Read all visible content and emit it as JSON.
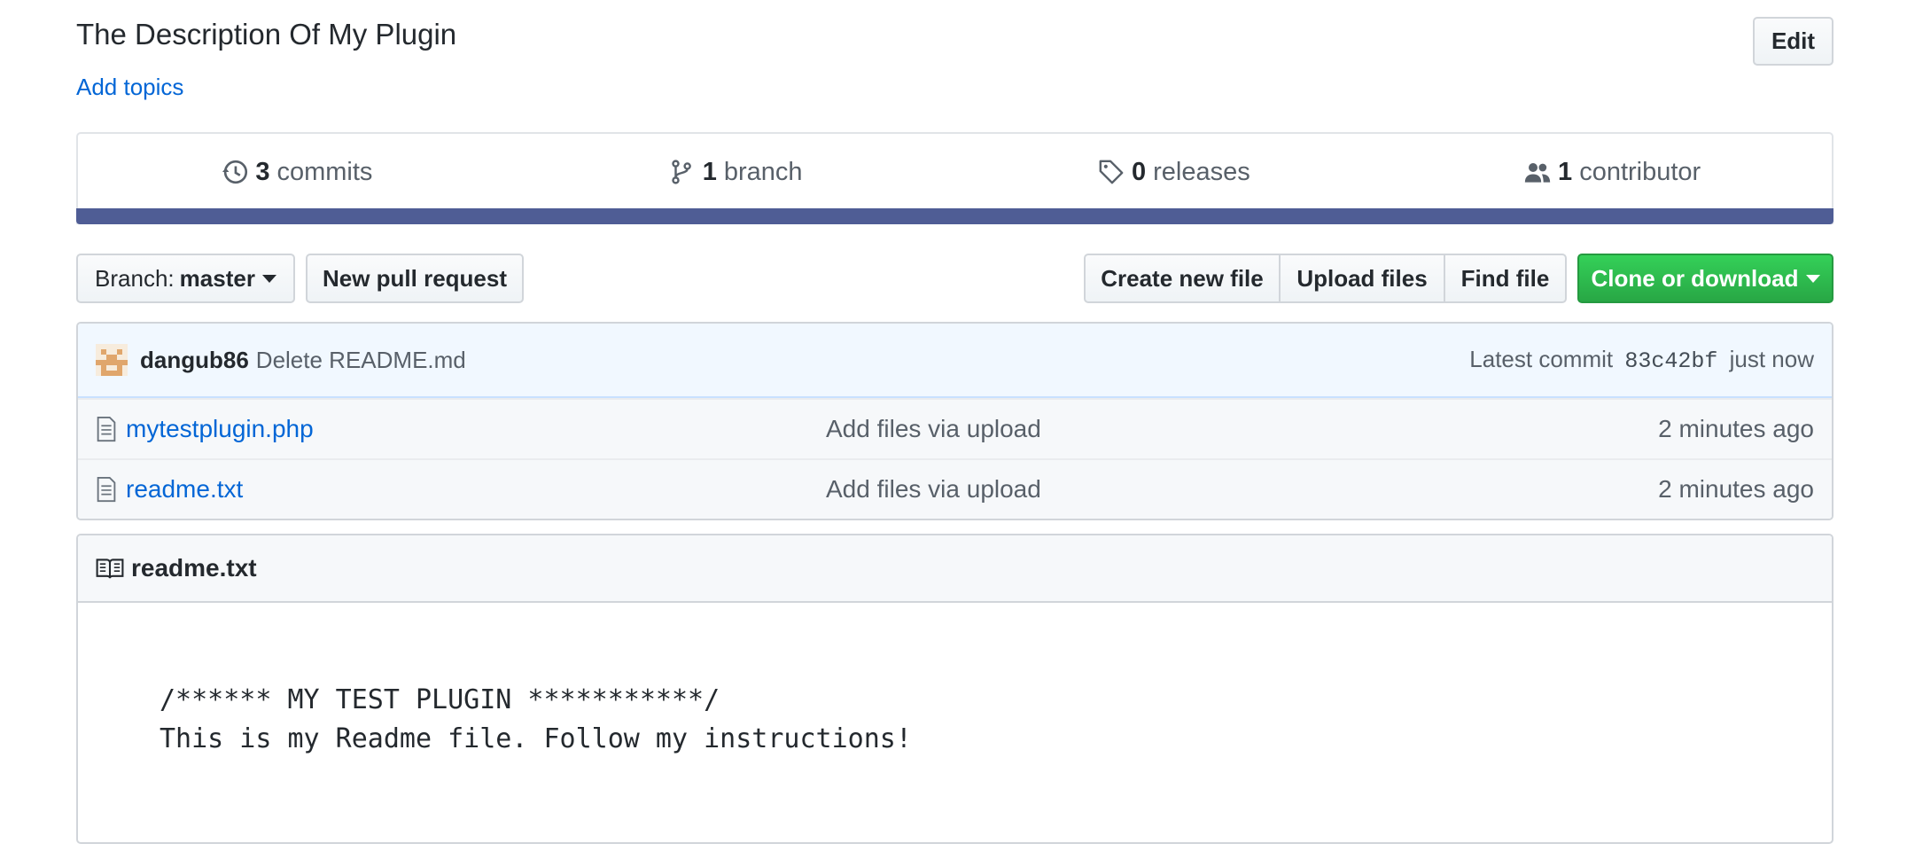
{
  "repo": {
    "description": "The Description Of My Plugin",
    "add_topics": "Add topics",
    "edit_label": "Edit"
  },
  "summary": {
    "commits_count": "3",
    "commits_label": "commits",
    "branches_count": "1",
    "branches_label": "branch",
    "releases_count": "0",
    "releases_label": "releases",
    "contributors_count": "1",
    "contributors_label": "contributor",
    "language_bar_color": "#4f5d95"
  },
  "toolbar": {
    "branch_prefix": "Branch:",
    "branch_name": "master",
    "new_pull_request": "New pull request",
    "create_new_file": "Create new file",
    "upload_files": "Upload files",
    "find_file": "Find file",
    "clone_or_download": "Clone or download"
  },
  "latest_commit": {
    "author": "dangub86",
    "message": "Delete README.md",
    "prefix": "Latest commit",
    "sha": "83c42bf",
    "time": "just now"
  },
  "files": [
    {
      "name": "mytestplugin.php",
      "message": "Add files via upload",
      "age": "2 minutes ago",
      "icon": "file-icon"
    },
    {
      "name": "readme.txt",
      "message": "Add files via upload",
      "age": "2 minutes ago",
      "icon": "file-icon"
    }
  ],
  "readme": {
    "title": "readme.txt",
    "line1": "/****** MY TEST PLUGIN ***********/",
    "line2": "This is my Readme file. Follow my instructions!"
  },
  "colors": {
    "link": "#0366d6",
    "clone_green": "#28a745",
    "commit_bar_bg": "#f1f8ff"
  }
}
